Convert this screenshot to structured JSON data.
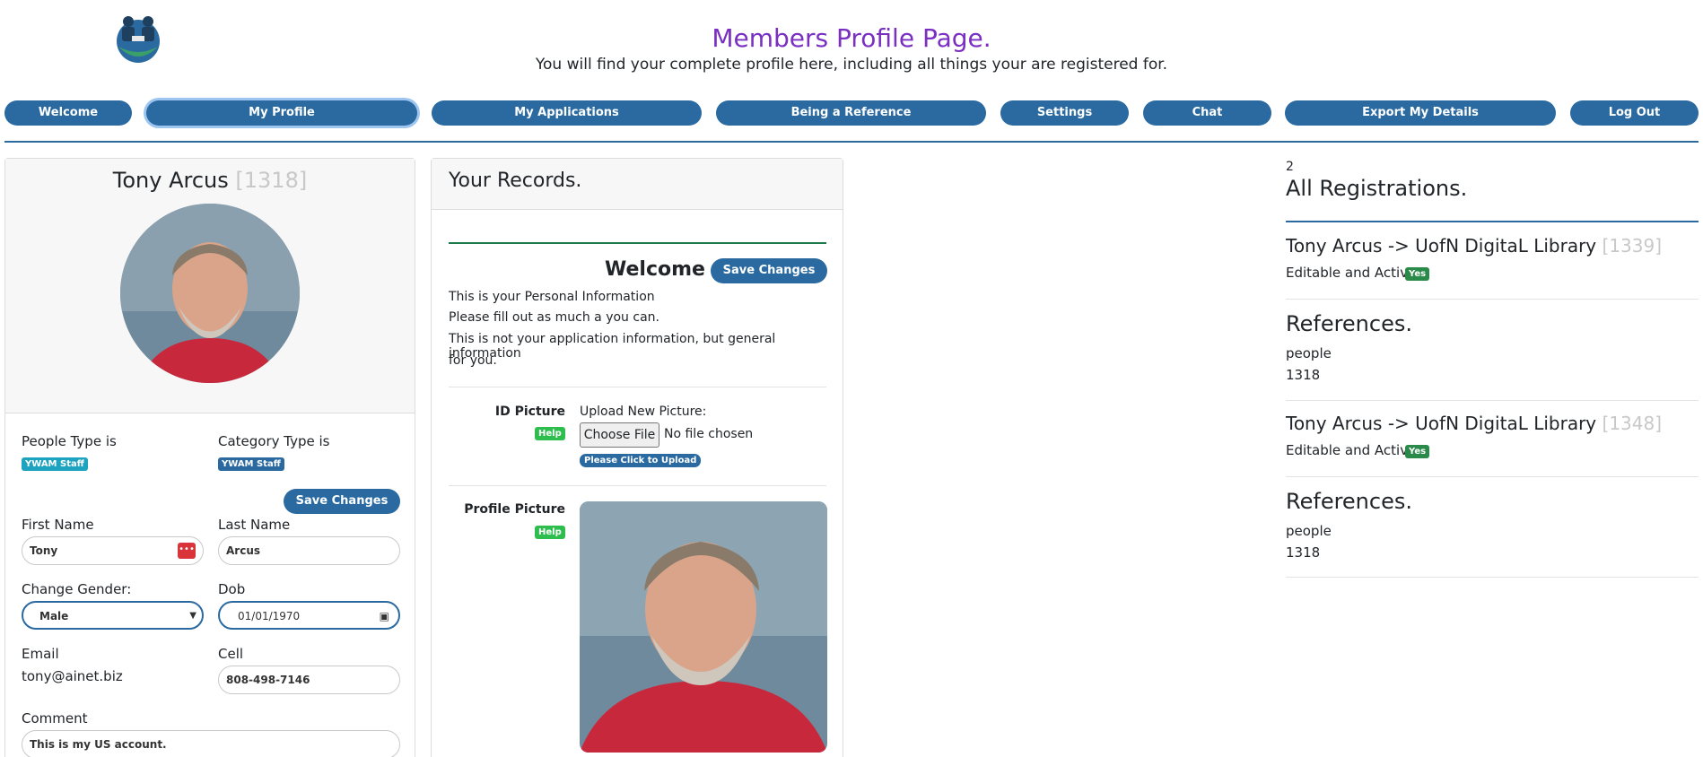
{
  "header": {
    "title": "Members Profile Page.",
    "subtitle": "You will find your complete profile here, including all things your are registered for."
  },
  "nav": [
    {
      "label": "Welcome"
    },
    {
      "label": "My Profile"
    },
    {
      "label": "My Applications"
    },
    {
      "label": "Being a Reference"
    },
    {
      "label": "Settings"
    },
    {
      "label": "Chat"
    },
    {
      "label": "Export My Details"
    },
    {
      "label": "Log Out"
    }
  ],
  "profile": {
    "name": "Tony Arcus",
    "id": "[1318]",
    "people_type_label": "People Type is",
    "people_type": "YWAM Staff",
    "category_type_label": "Category Type is",
    "category_type": "YWAM Staff",
    "save_label": "Save Changes",
    "first_name_label": "First Name",
    "first_name": "Tony",
    "last_name_label": "Last Name",
    "last_name": "Arcus",
    "gender_label": "Change Gender:",
    "gender": "Male",
    "dob_label": "Dob",
    "dob": "01/01/1970",
    "email_label": "Email",
    "email": "tony@ainet.biz",
    "cell_label": "Cell",
    "cell": "808-498-7146",
    "comment_label": "Comment",
    "comment": "This is my US account."
  },
  "records": {
    "title": "Your Records.",
    "welcome": "Welcome",
    "save_label": "Save Changes",
    "info": [
      "This is your Personal Information",
      "Please fill out as much a you can.",
      "This is not your application information, but general information",
      "for you."
    ],
    "id_picture_label": "ID Picture",
    "help": "Help",
    "upload_label": "Upload New Picture:",
    "choose_file": "Choose File",
    "no_file": "No file chosen",
    "upload_button": "Please Click to Upload",
    "profile_picture_label": "Profile Picture"
  },
  "registrations": {
    "count": "2",
    "title": "All Registrations.",
    "items": [
      {
        "name": "Tony Arcus -> UofN DigitaL Library",
        "id": "[1339]",
        "editable_label": "Editable and Active?",
        "editable": "Yes",
        "refs_title": "References.",
        "refs_type": "people",
        "refs_id": "1318"
      },
      {
        "name": "Tony Arcus -> UofN DigitaL Library",
        "id": "[1348]",
        "editable_label": "Editable and Active?",
        "editable": "Yes",
        "refs_title": "References.",
        "refs_type": "people",
        "refs_id": "1318"
      }
    ]
  },
  "colors": {
    "accent": "#2a6aa0",
    "title": "#7a2fc2",
    "badge_green": "#2dbe4e"
  }
}
